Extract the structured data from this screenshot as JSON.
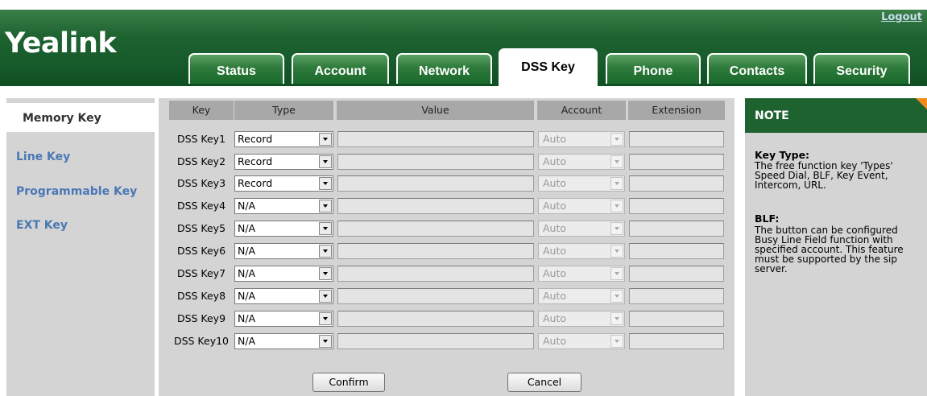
{
  "header": {
    "logo": "Yealink",
    "logout": "Logout"
  },
  "tabs": [
    {
      "label": "Status"
    },
    {
      "label": "Account"
    },
    {
      "label": "Network"
    },
    {
      "label": "DSS Key",
      "active": true
    },
    {
      "label": "Phone"
    },
    {
      "label": "Contacts"
    },
    {
      "label": "Security"
    }
  ],
  "sidebar": {
    "items": [
      {
        "label": "Memory Key",
        "active": true
      },
      {
        "label": "Line Key"
      },
      {
        "label": "Programmable Key"
      },
      {
        "label": "EXT Key"
      }
    ]
  },
  "table": {
    "headers": [
      "Key",
      "Type",
      "Value",
      "Account",
      "Extension"
    ],
    "rows": [
      {
        "key": "DSS Key1",
        "type": "Record",
        "value": "",
        "account": "Auto",
        "extension": ""
      },
      {
        "key": "DSS Key2",
        "type": "Record",
        "value": "",
        "account": "Auto",
        "extension": ""
      },
      {
        "key": "DSS Key3",
        "type": "Record",
        "value": "",
        "account": "Auto",
        "extension": ""
      },
      {
        "key": "DSS Key4",
        "type": "N/A",
        "value": "",
        "account": "Auto",
        "extension": ""
      },
      {
        "key": "DSS Key5",
        "type": "N/A",
        "value": "",
        "account": "Auto",
        "extension": ""
      },
      {
        "key": "DSS Key6",
        "type": "N/A",
        "value": "",
        "account": "Auto",
        "extension": ""
      },
      {
        "key": "DSS Key7",
        "type": "N/A",
        "value": "",
        "account": "Auto",
        "extension": ""
      },
      {
        "key": "DSS Key8",
        "type": "N/A",
        "value": "",
        "account": "Auto",
        "extension": ""
      },
      {
        "key": "DSS Key9",
        "type": "N/A",
        "value": "",
        "account": "Auto",
        "extension": ""
      },
      {
        "key": "DSS Key10",
        "type": "N/A",
        "value": "",
        "account": "Auto",
        "extension": ""
      }
    ]
  },
  "buttons": {
    "confirm": "Confirm",
    "cancel": "Cancel"
  },
  "note": {
    "heading": "NOTE",
    "sections": [
      {
        "title": "Key Type:",
        "lines": [
          "The free function key 'Types'",
          "Speed Dial, BLF, Key Event,",
          "Intercom, URL."
        ]
      },
      {
        "title": "BLF:",
        "lines": [
          "The button can be configured",
          "Busy Line Field function with",
          "specified account. This feature",
          "must be supported by the sip",
          "server."
        ]
      }
    ]
  },
  "colors": {
    "brand_green": "#1e6230",
    "nav_link": "#4a78b5",
    "panel_gray": "#d4d4d4",
    "header_gray": "#a8a8a8",
    "note_corner": "#f08a1c"
  }
}
